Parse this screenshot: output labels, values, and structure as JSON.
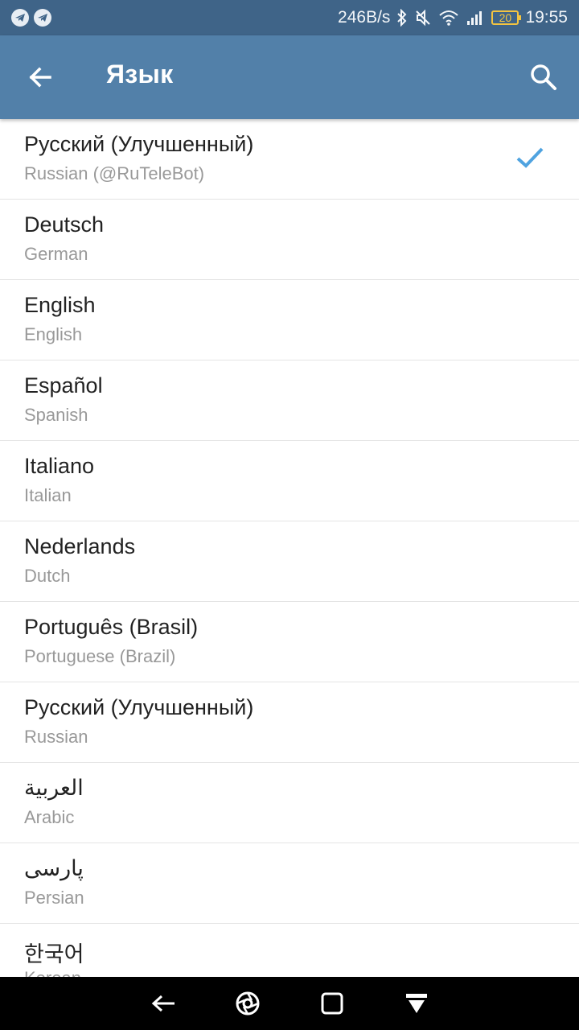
{
  "status_bar": {
    "speed": "246B/s",
    "battery": "20",
    "time": "19:55",
    "icons": [
      "telegram-icon",
      "telegram-icon",
      "bluetooth-icon",
      "mute-icon",
      "wifi-icon",
      "signal-icon",
      "battery-icon"
    ]
  },
  "toolbar": {
    "title": "Язык",
    "back_icon": "arrow-left-icon",
    "search_icon": "search-icon"
  },
  "languages": [
    {
      "name": "Русский (Улучшенный)",
      "sub": "Russian (@RuTeleBot)",
      "selected": true
    },
    {
      "name": "Deutsch",
      "sub": "German"
    },
    {
      "name": "English",
      "sub": "English"
    },
    {
      "name": "Español",
      "sub": "Spanish"
    },
    {
      "name": "Italiano",
      "sub": "Italian"
    },
    {
      "name": "Nederlands",
      "sub": "Dutch"
    },
    {
      "name": "Português (Brasil)",
      "sub": "Portuguese (Brazil)"
    },
    {
      "name": "Русский (Улучшенный)",
      "sub": "Russian"
    },
    {
      "name": "العربية",
      "sub": "Arabic"
    },
    {
      "name": "پارسی",
      "sub": "Persian"
    },
    {
      "name": "한국어",
      "sub": "Korean"
    }
  ],
  "nav_bar": {
    "icons": [
      "back-icon",
      "home-icon",
      "recents-icon",
      "notifications-icon"
    ]
  },
  "colors": {
    "status_bar": "#3f6488",
    "toolbar": "#5280a9",
    "check": "#4fa3e0",
    "primary_text": "#222222",
    "secondary_text": "#999999"
  }
}
